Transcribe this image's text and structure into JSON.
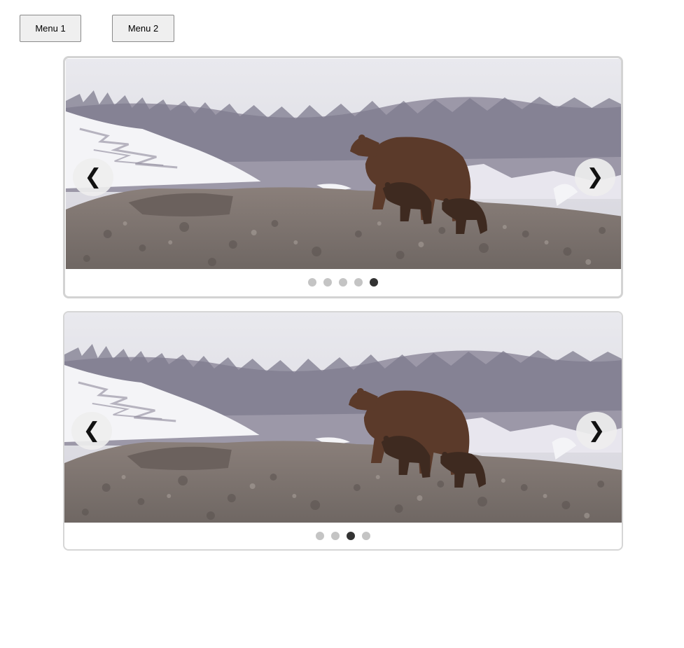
{
  "menus": [
    {
      "label": "Menu 1"
    },
    {
      "label": "Menu 2"
    }
  ],
  "carousels": [
    {
      "prev_glyph": "❮",
      "next_glyph": "❯",
      "slide_count": 5,
      "active_index": 4,
      "image": "brown-bear-with-cubs-on-rocky-hillside"
    },
    {
      "prev_glyph": "❮",
      "next_glyph": "❯",
      "slide_count": 4,
      "active_index": 2,
      "image": "brown-bear-with-cubs-on-rocky-hillside"
    }
  ],
  "colors": {
    "dot_inactive": "#c4c4c4",
    "dot_active": "#333333"
  }
}
